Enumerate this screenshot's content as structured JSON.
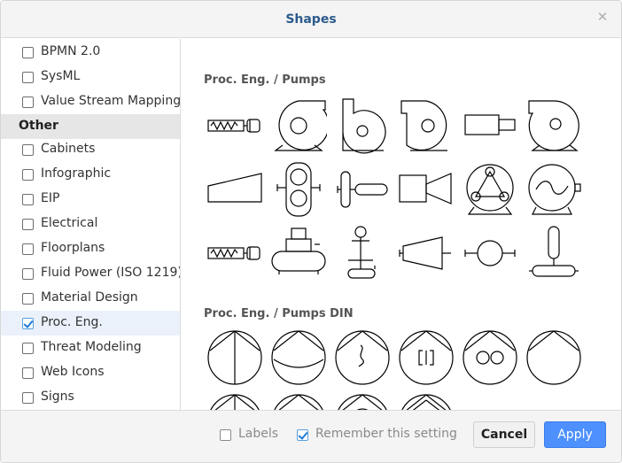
{
  "dialog": {
    "title": "Shapes",
    "close_glyph": "✕"
  },
  "sidebar": {
    "items_top": [
      {
        "label": "BPMN 2.0",
        "checked": false
      },
      {
        "label": "SysML",
        "checked": false
      },
      {
        "label": "Value Stream Mapping",
        "checked": false
      }
    ],
    "group_header": "Other",
    "items_other": [
      {
        "label": "Cabinets",
        "checked": false
      },
      {
        "label": "Infographic",
        "checked": false
      },
      {
        "label": "EIP",
        "checked": false
      },
      {
        "label": "Electrical",
        "checked": false
      },
      {
        "label": "Floorplans",
        "checked": false
      },
      {
        "label": "Fluid Power (ISO 1219)",
        "checked": false
      },
      {
        "label": "Material Design",
        "checked": false
      },
      {
        "label": "Proc. Eng.",
        "checked": true
      },
      {
        "label": "Threat Modeling",
        "checked": false
      },
      {
        "label": "Web Icons",
        "checked": false
      },
      {
        "label": "Signs",
        "checked": false
      }
    ]
  },
  "content": {
    "sections": [
      {
        "title": "Proc. Eng. / Pumps"
      },
      {
        "title": "Proc. Eng. / Pumps DIN"
      }
    ]
  },
  "footer": {
    "labels_checkbox": {
      "label": "Labels",
      "checked": false
    },
    "remember_checkbox": {
      "label": "Remember this setting",
      "checked": true
    },
    "cancel_label": "Cancel",
    "apply_label": "Apply"
  },
  "colors": {
    "accent": "#4d90fe",
    "title_text": "#2c5a8c",
    "selected_row": "#eaf1fa"
  }
}
